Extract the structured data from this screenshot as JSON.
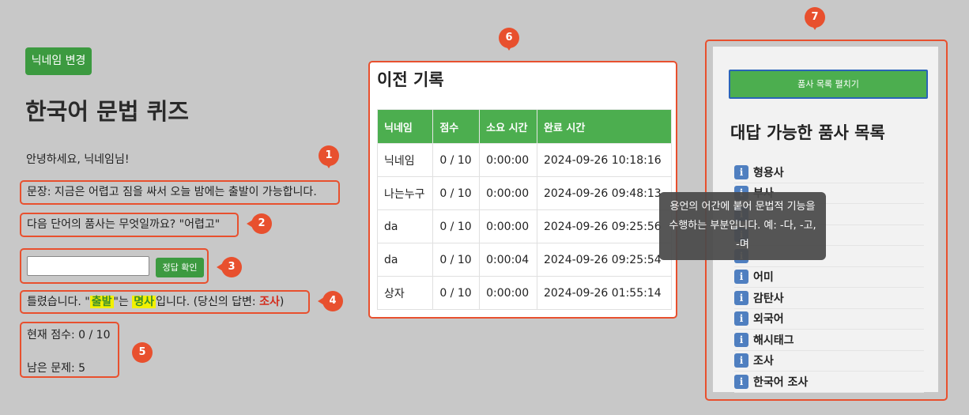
{
  "header": {
    "nickname_button": "닉네임 변경",
    "title": "한국어 문법 퀴즈"
  },
  "quiz": {
    "greeting": "안녕하세요, 닉네임님!",
    "sentence": "문장: 지금은 어렵고 짐을 싸서 오늘 밤에는 출발이 가능합니다.",
    "question": "다음 단어의 품사는 무엇일까요? \"어렵고\"",
    "answer_value": "",
    "check_button": "정답 확인",
    "feedback": {
      "prefix": "틀렸습니다. \"",
      "word": "출발",
      "mid": "\"는 ",
      "pos": "명사",
      "suffix": "입니다. (당신의 답변: ",
      "user_answer": "조사",
      "close": ")"
    },
    "current_score": "현재 점수: 0 / 10",
    "remaining": "남은 문제: 5"
  },
  "markers": [
    "1",
    "2",
    "3",
    "4",
    "5",
    "6",
    "7"
  ],
  "history": {
    "title": "이전 기록",
    "columns": [
      "닉네임",
      "점수",
      "소요 시간",
      "완료 시간"
    ],
    "rows": [
      [
        "닉네임",
        "0 / 10",
        "0:00:00",
        "2024-09-26 10:18:16"
      ],
      [
        "나는누구",
        "0 / 10",
        "0:00:00",
        "2024-09-26 09:48:13"
      ],
      [
        "da",
        "0 / 10",
        "0:00:00",
        "2024-09-26 09:25:56"
      ],
      [
        "da",
        "0 / 10",
        "0:00:04",
        "2024-09-26 09:25:54"
      ],
      [
        "상자",
        "0 / 10",
        "0:00:00",
        "2024-09-26 01:55:14"
      ]
    ]
  },
  "pos_panel": {
    "expand_button": "품사 목록 펼치기",
    "heading": "대답 가능한 품사 목록",
    "items": [
      "형용사",
      "부사",
      "",
      "",
      "",
      "어미",
      "감탄사",
      "외국어",
      "해시태그",
      "조사",
      "한국어 조사"
    ]
  },
  "tooltip": {
    "text": "용언의 어간에 붙어 문법적 기능을 수행하는 부분입니다. 예: -다, -고, -며"
  },
  "colors": {
    "accent_green": "#4cae4f",
    "callout_red": "#e8502e",
    "highlight": "#f2f000"
  }
}
